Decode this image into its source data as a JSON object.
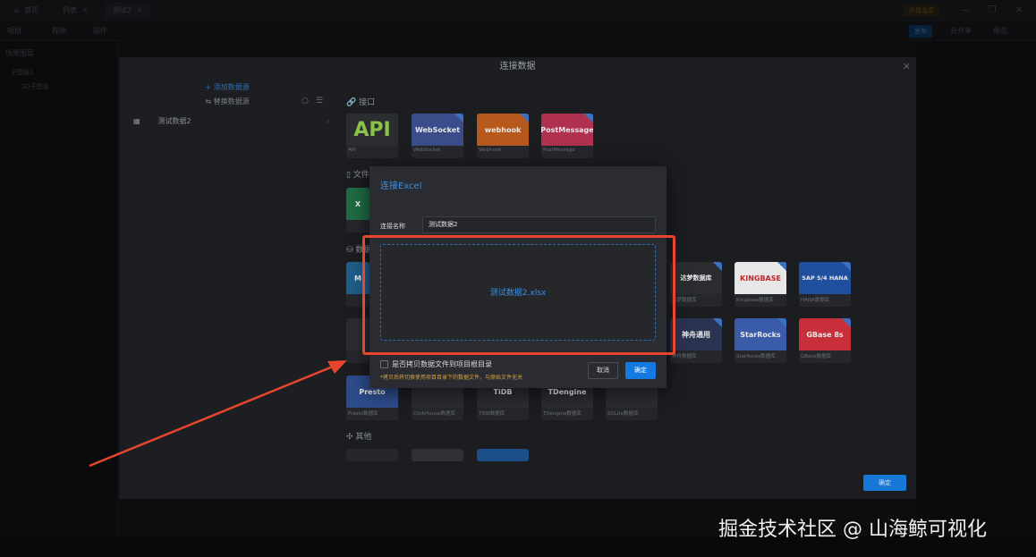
{
  "tabs": [
    {
      "label": "首页"
    },
    {
      "label": "列表"
    },
    {
      "label": "测试2"
    }
  ],
  "top_right": {
    "upgrade_label": "升级会员"
  },
  "toolbar": {
    "items": [
      "项目",
      "视频",
      "操作"
    ],
    "publish_label": "发布",
    "share_label": "云共享",
    "preview_label": "预览"
  },
  "left_panel": {
    "title": "场景图层",
    "items": [
      "子图层1",
      "3D子图层"
    ]
  },
  "outer_dialog": {
    "title": "连接数据",
    "add_data_source": "+ 添加数据源",
    "switch_data_source": "替换数据源",
    "data_source_item": "测试数据2",
    "sections": {
      "interface": "接口",
      "file": "文件",
      "database": "数据",
      "other": "其他"
    },
    "interface_cards": [
      {
        "thumb": "API",
        "caption": "API",
        "color": "#2b2d31"
      },
      {
        "thumb": "WebSocket",
        "caption": "WebSocket",
        "color": "#3b4c8a"
      },
      {
        "thumb": "webhook",
        "caption": "Webhook",
        "color": "#b55a1c"
      },
      {
        "thumb": "PostMessage",
        "caption": "PostMessage",
        "color": "#b0304f"
      }
    ],
    "db_cards_row1": [
      {
        "thumb": "达梦数据库",
        "caption": "达梦数据库",
        "color": "#2a2c30"
      },
      {
        "thumb": "KINGBASE",
        "caption": "Kingbase数据库",
        "color": "#e7e7e7"
      },
      {
        "thumb": "SAP S/4 HANA",
        "caption": "HANA数据库",
        "color": "#1f4f9e"
      }
    ],
    "db_cards_row2": [
      {
        "thumb": "神舟通用",
        "caption": "神舟数据库",
        "color": "#2a3350"
      },
      {
        "thumb": "StarRocks",
        "caption": "StarRocks数据库",
        "color": "#3a5ba7"
      },
      {
        "thumb": "GBase 8s",
        "caption": "GBase数据库",
        "color": "#c7303a"
      }
    ],
    "db_cards_row3_captions": [
      "Presto数据库",
      "ClickHouse数据库",
      "TiDB数据库",
      "TDengine数据库",
      "SQLite数据库"
    ],
    "confirm_label": "确定"
  },
  "excel_dialog": {
    "title": "连接Excel",
    "name_label": "连接名称",
    "name_value": "测试数据2",
    "file_name": "测试数据2.xlsx",
    "copy_checkbox_label": "是否拷贝数据文件到项目根目录",
    "copy_hint": "*拷贝后将切换使用项目目录下的数据文件，与原始文件无关",
    "cancel_label": "取消",
    "ok_label": "确定"
  },
  "watermark": "掘金技术社区 @ 山海鲸可视化",
  "colors": {
    "accent": "#1479e0",
    "highlight": "#e5462d",
    "warning": "#d9a33b"
  }
}
